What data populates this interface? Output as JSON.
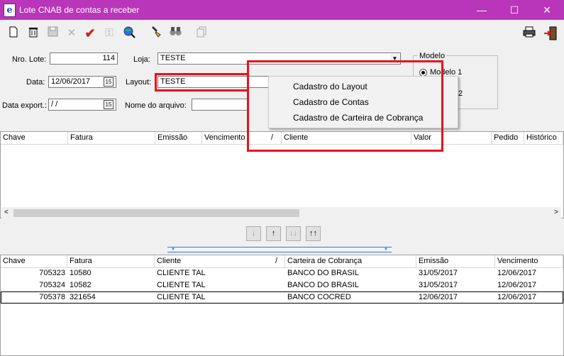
{
  "window": {
    "app_icon_glyph": "e",
    "title": "Lote CNAB de contas a receber",
    "controls": {
      "minimize": "—",
      "maximize": "☐",
      "close": "✕"
    }
  },
  "toolbar": {
    "icons": [
      "new-document-icon",
      "delete-trash-icon",
      "save-disk-icon",
      "cancel-x-icon",
      "confirm-check-icon",
      "lock-icon",
      "search-globe-icon",
      "filter-icon",
      "binoculars-icon",
      "copy-icon"
    ],
    "right_icons": [
      "print-icon",
      "exit-door-icon"
    ]
  },
  "form": {
    "nro_lote_label": "Nro. Lote:",
    "nro_lote_value": "114",
    "loja_label": "Loja:",
    "loja_value": "TESTE",
    "data_label": "Data:",
    "data_value": "12/06/2017",
    "layout_label": "Layout:",
    "layout_value": "TESTE",
    "data_export_label": "Data export.:",
    "data_export_value": " / /",
    "nome_arquivo_label": "Nome do arquivo:",
    "nome_arquivo_value": ""
  },
  "modelo": {
    "legend": "Modelo",
    "option1": "Modelo 1",
    "option2_fragment": "2"
  },
  "context_menu": {
    "items": [
      "Cadastro do Layout",
      "Cadastro de Contas",
      "Cadastro de Carteira de Cobrança"
    ]
  },
  "top_grid": {
    "columns": [
      "Chave",
      "Fatura",
      "Emissão",
      "Vencimento",
      "Cliente",
      "Valor",
      "Pedido",
      "Histórico"
    ],
    "sort_marker": "/"
  },
  "nav_buttons": [
    "↓",
    "↑",
    "↓↓",
    "↑↑"
  ],
  "bottom_grid": {
    "columns": [
      "Chave",
      "Fatura",
      "Cliente",
      "Carteira de Cobrança",
      "Emissão",
      "Vencimento"
    ],
    "sort_marker": "/",
    "rows": [
      {
        "chave": "705323",
        "fatura": "10580",
        "cliente": "CLIENTE TAL",
        "carteira": "BANCO DO BRASIL",
        "emissao": "31/05/2017",
        "vencimento": "12/06/2017"
      },
      {
        "chave": "705324",
        "fatura": "10582",
        "cliente": "CLIENTE TAL",
        "carteira": "BANCO DO BRASIL",
        "emissao": "31/05/2017",
        "vencimento": "12/06/2017"
      },
      {
        "chave": "705378",
        "fatura": "321654",
        "cliente": "CLIENTE TAL",
        "carteira": "BANCO COCRED",
        "emissao": "12/06/2017",
        "vencimento": "12/06/2017"
      }
    ]
  },
  "colors": {
    "titlebar": "#b935b9",
    "highlight": "#e8121f"
  }
}
